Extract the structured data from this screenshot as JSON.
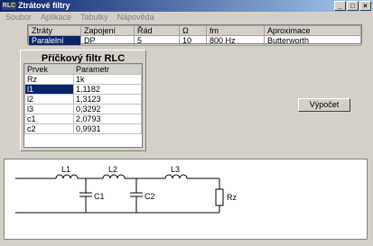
{
  "window": {
    "title": "Ztrátové filtry",
    "app_icon": "RLC",
    "controls": [
      "_",
      "□",
      "×"
    ]
  },
  "menu": [
    "Soubor",
    "Aplikace",
    "Tabulky",
    "Nápověda"
  ],
  "top_table": {
    "headers": [
      "Ztráty",
      "Zapojení",
      "Řád",
      "Ω",
      "fm",
      "Aproximace"
    ],
    "row": [
      "Paralelní",
      "DP",
      "5",
      "10",
      "800 Hz",
      "Butterworth"
    ]
  },
  "rlc": {
    "title": "Příčkový filtr RLC",
    "headers": [
      "Prvek",
      "Parametr"
    ],
    "rows": [
      [
        "Rz",
        "1k"
      ],
      [
        "l1",
        "1,1182"
      ],
      [
        "l2",
        "1,3123"
      ],
      [
        "l3",
        "0,3292"
      ],
      [
        "c1",
        "2,0793"
      ],
      [
        "c2",
        "0,9931"
      ]
    ]
  },
  "calc_button": "Výpočet",
  "circuit": {
    "labels": [
      "L1",
      "L2",
      "L3",
      "C1",
      "C2",
      "Rz"
    ]
  }
}
